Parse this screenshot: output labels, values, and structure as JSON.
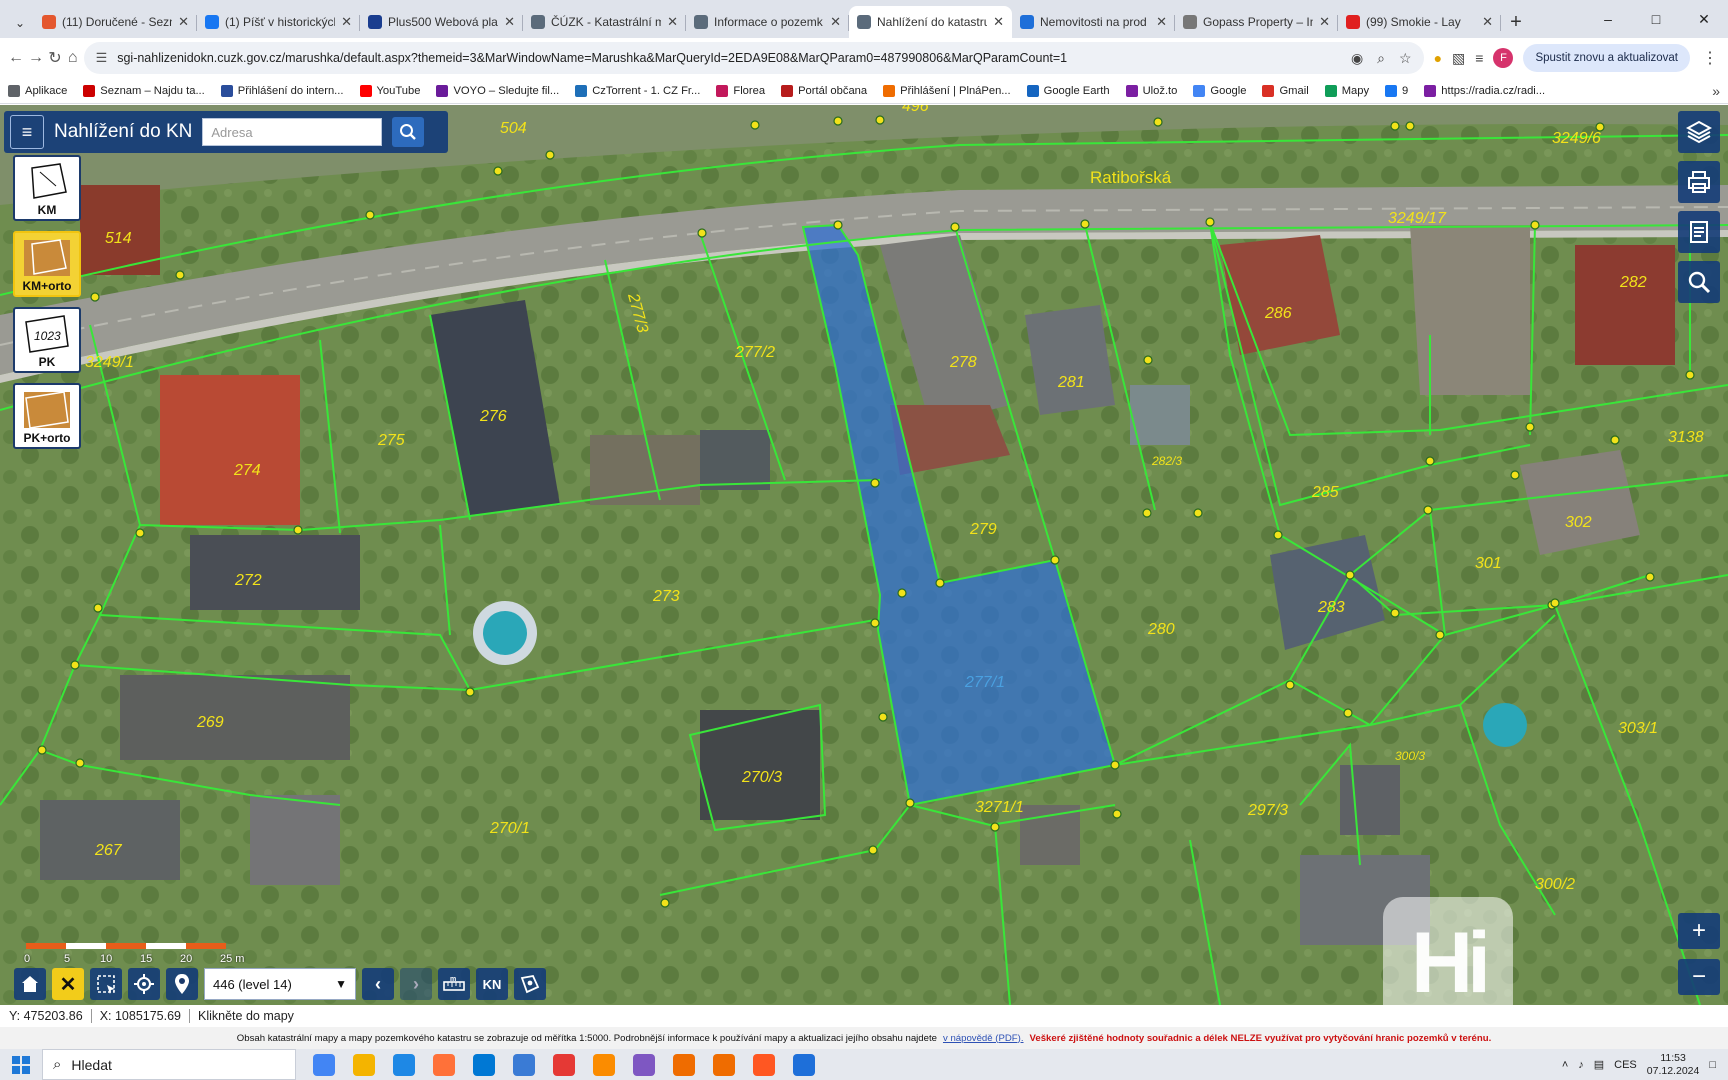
{
  "browser": {
    "tabs": [
      {
        "title": "(11) Doručené - Sezn",
        "color": "#e4572e"
      },
      {
        "title": "(1) Píšť v historických",
        "color": "#1877f2"
      },
      {
        "title": "Plus500 Webová plat",
        "color": "#1a3d8f"
      },
      {
        "title": "ČÚZK - Katastrální m",
        "color": "#5b6b7b"
      },
      {
        "title": "Informace o pozemk",
        "color": "#5b6b7b"
      },
      {
        "title": "Nahlížení do katastru",
        "color": "#5b6b7b"
      },
      {
        "title": "Nemovitosti na prod",
        "color": "#1e6fd9"
      },
      {
        "title": "Gopass Property – In",
        "color": "#777777"
      },
      {
        "title": "(99) Smokie - Lay",
        "color": "#e02020"
      }
    ],
    "url": "sgi-nahlizenidokn.cuzk.gov.cz/marushka/default.aspx?themeid=3&MarWindowName=Marushka&MarQueryId=2EDA9E08&MarQParam0=487990806&MarQParamCount=1",
    "profile_initial": "F",
    "update_label": "Spustit znovu a aktualizovat",
    "bookmarks": [
      {
        "label": "Aplikace",
        "color": "#5f6368"
      },
      {
        "label": "Seznam – Najdu ta...",
        "color": "#cc0000"
      },
      {
        "label": "Přihlášení do intern...",
        "color": "#2a4d9b"
      },
      {
        "label": "YouTube",
        "color": "#ff0000"
      },
      {
        "label": "VOYO – Sledujte fil...",
        "color": "#6a1b9a"
      },
      {
        "label": "CzTorrent - 1. CZ Fr...",
        "color": "#1e6fb8"
      },
      {
        "label": "Florea",
        "color": "#c2185b"
      },
      {
        "label": "Portál občana",
        "color": "#b71c1c"
      },
      {
        "label": "Přihlášení | PlnáPen...",
        "color": "#ef6c00"
      },
      {
        "label": "Google Earth",
        "color": "#1565c0"
      },
      {
        "label": "Ulož.to",
        "color": "#7b1fa2"
      },
      {
        "label": "Google",
        "color": "#4285f4"
      },
      {
        "label": "Gmail",
        "color": "#d93025"
      },
      {
        "label": "Mapy",
        "color": "#0f9d58"
      },
      {
        "label": "9",
        "color": "#1877f2"
      },
      {
        "label": "https://radia.cz/radi...",
        "color": "#7b1fa2"
      }
    ]
  },
  "app": {
    "title": "Nahlížení do KN",
    "search_placeholder": "Adresa",
    "layers": [
      {
        "label": "KM",
        "active": false
      },
      {
        "label": "KM+orto",
        "active": true
      },
      {
        "label": "PK",
        "active": false
      },
      {
        "label": "PK+orto",
        "active": false
      }
    ],
    "level_select": "446 (level 14)",
    "kn_button": "KN",
    "scale_labels": [
      "0",
      "5",
      "10",
      "15",
      "20",
      "25 m"
    ],
    "watermark": "Hi",
    "street_name": "Ratibořská",
    "highlight_color": "#2f6fd6",
    "parcel_line_color": "#39e639",
    "building_line_color": "#f2e21a",
    "parcels": [
      "504",
      "496",
      "514",
      "3249/6",
      "3249/17",
      "3249/1",
      "277/3",
      "277/2",
      "276",
      "275",
      "274",
      "278",
      "281",
      "286",
      "282",
      "3138",
      "282/3",
      "285",
      "302",
      "279",
      "272",
      "273",
      "301",
      "283",
      "280",
      "277/1",
      "269",
      "270/3",
      "303/1",
      "300/3",
      "270/1",
      "3271/1",
      "297/3",
      "300/2",
      "267"
    ]
  },
  "status": {
    "y": "Y: 475203.86",
    "x": "X: 1085175.69",
    "hint": "Klikněte do mapy"
  },
  "info": {
    "text": "Obsah katastrální mapy a mapy pozemkového katastru se zobrazuje od měřítka 1:5000. Podrobnější informace k používání mapy a aktualizaci jejího obsahu najdete",
    "link": "v nápovědě (PDF).",
    "warning": "Veškeré zjištěné hodnoty souřadnic a délek NELZE využívat pro vytyčování hranic pozemků v terénu."
  },
  "taskbar": {
    "search": "Hledat",
    "language": "CES",
    "time": "11:53",
    "date": "07.12.2024",
    "apps": [
      "#4285f4",
      "#f4b400",
      "#1e88e5",
      "#ff7139",
      "#0078d4",
      "#3a7bd5",
      "#e53935",
      "#fb8c00",
      "#7e57c2",
      "#ef6c00",
      "#ef6c00",
      "#ff5722",
      "#1e6fd9"
    ]
  }
}
